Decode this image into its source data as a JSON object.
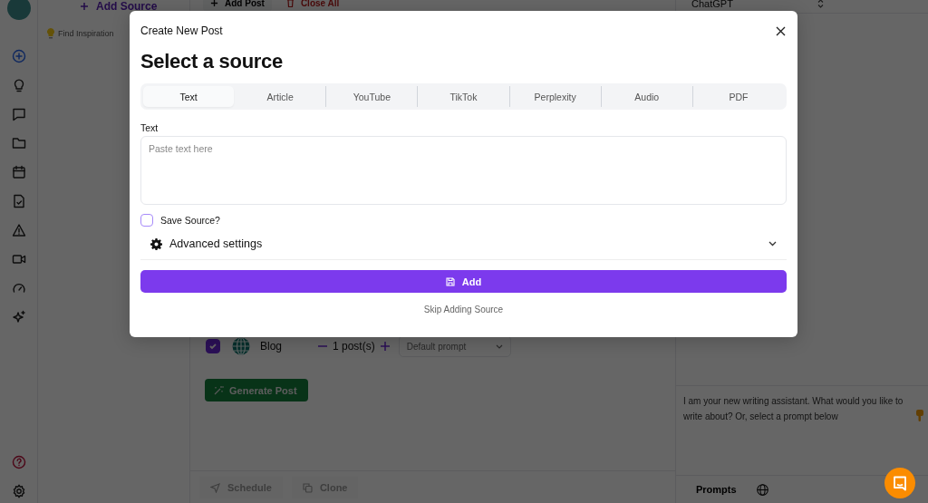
{
  "source_panel": {
    "add_button": "Add Source",
    "inspiration_link": "Find Inspiration"
  },
  "toolbar": {
    "add_post": "Add Post",
    "close_all": "Close All"
  },
  "platforms": [
    {
      "name": "Blog",
      "checked": true,
      "count": "1 post(s)",
      "prompt": "Default prompt"
    }
  ],
  "generate_button": "Generate Post",
  "footer_buttons": [
    "Schedule",
    "Clone"
  ],
  "assistant": {
    "model": "ChatGPT",
    "message": "I am your new writing assistant. What would you like to write about? Or, select a prompt below",
    "prompts_tab": "Prompts"
  },
  "modal": {
    "title": "Create New Post",
    "heading": "Select a source",
    "tabs": [
      {
        "label": "Text",
        "selected": true
      },
      {
        "label": "Article",
        "selected": false
      },
      {
        "label": "YouTube",
        "selected": false
      },
      {
        "label": "TikTok",
        "selected": false
      },
      {
        "label": "Perplexity",
        "selected": false
      },
      {
        "label": "Audio",
        "selected": false
      },
      {
        "label": "PDF",
        "selected": false
      }
    ],
    "field_label": "Text",
    "placeholder": "Paste text here",
    "save_source": {
      "label": "Save Source?",
      "checked": false
    },
    "advanced": {
      "label": "Advanced settings",
      "expanded": false
    },
    "submit": "Add",
    "skip": "Skip Adding Source"
  }
}
